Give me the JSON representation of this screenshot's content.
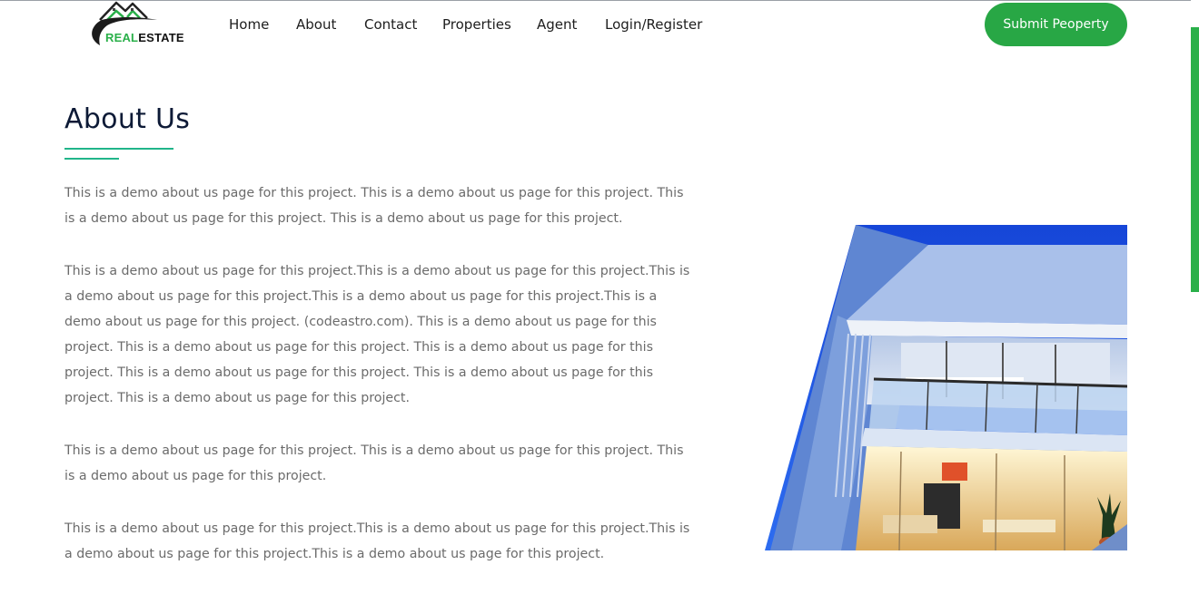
{
  "brand": {
    "logo_text_1": "REAL",
    "logo_text_2": "ESTATE",
    "accent": "#2ab04a"
  },
  "nav": {
    "items": [
      {
        "label": "Home"
      },
      {
        "label": "About"
      },
      {
        "label": "Contact"
      },
      {
        "label": "Properties"
      },
      {
        "label": "Agent"
      },
      {
        "label": "Login/Register"
      }
    ]
  },
  "header": {
    "cta_label": "Submit Peoperty",
    "cta_color": "#28a745"
  },
  "main": {
    "title": "About Us",
    "underline_color": "#21b58a",
    "paragraphs": [
      "This is a demo about us page for this project. This is a demo about us page for this project. This is a demo about us page for this project. This is a demo about us page for this project.",
      "This is a demo about us page for this project.This is a demo about us page for this project.This is a demo about us page for this project.This is a demo about us page for this project.This is a demo about us page for this project. (codeastro.com). This is a demo about us page for this project. This is a demo about us page for this project. This is a demo about us page for this project. This is a demo about us page for this project. This is a demo about us page for this project. This is a demo about us page for this project.",
      "This is a demo about us page for this project. This is a demo about us page for this project. This is a demo about us page for this project.",
      "This is a demo about us page for this project.This is a demo about us page for this project.This is a demo about us page for this project.This is a demo about us page for this project."
    ]
  },
  "image": {
    "subject": "modern-house-photo",
    "sky_color": "#1c52e6"
  }
}
